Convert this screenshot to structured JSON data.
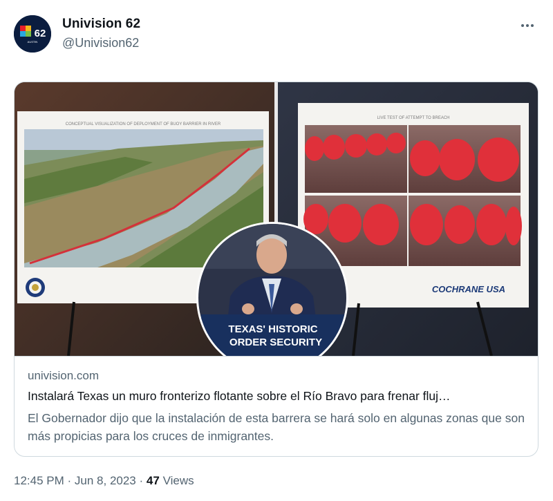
{
  "tweet": {
    "author": {
      "display_name": "Univision 62",
      "handle": "@Univision62",
      "avatar_text": "62",
      "avatar_subtext": "AUSTIN"
    },
    "more_icon": "more-horizontal-icon",
    "link_card": {
      "domain": "univision.com",
      "title": "Instalará Texas un muro fronterizo flotante sobre el Río Bravo para frenar fluj…",
      "description": "El Gobernador dijo que la instalación de esta barrera se hará solo en algunas zonas que son más propicias para los cruces de inmigrantes.",
      "image": {
        "left_poster_caption": "CONCEPTUAL VISUALIZATION OF DEPLOYMENT OF BUOY BARRIER IN RIVER",
        "right_poster_caption": "LIVE TEST OF ATTEMPT TO BREACH",
        "right_poster_brand": "COCHRANE USA",
        "podium_sign_line1": "TEXAS' HISTORIC",
        "podium_sign_line2": "ORDER SECURITY"
      }
    },
    "meta": {
      "time": "12:45 PM",
      "separator": "·",
      "date": "Jun 8, 2023",
      "views_count": "47",
      "views_label": "Views"
    }
  },
  "colors": {
    "text_primary": "#0f1419",
    "text_secondary": "#536471",
    "border": "#cfd9de",
    "buoy_red": "#e0303a"
  }
}
